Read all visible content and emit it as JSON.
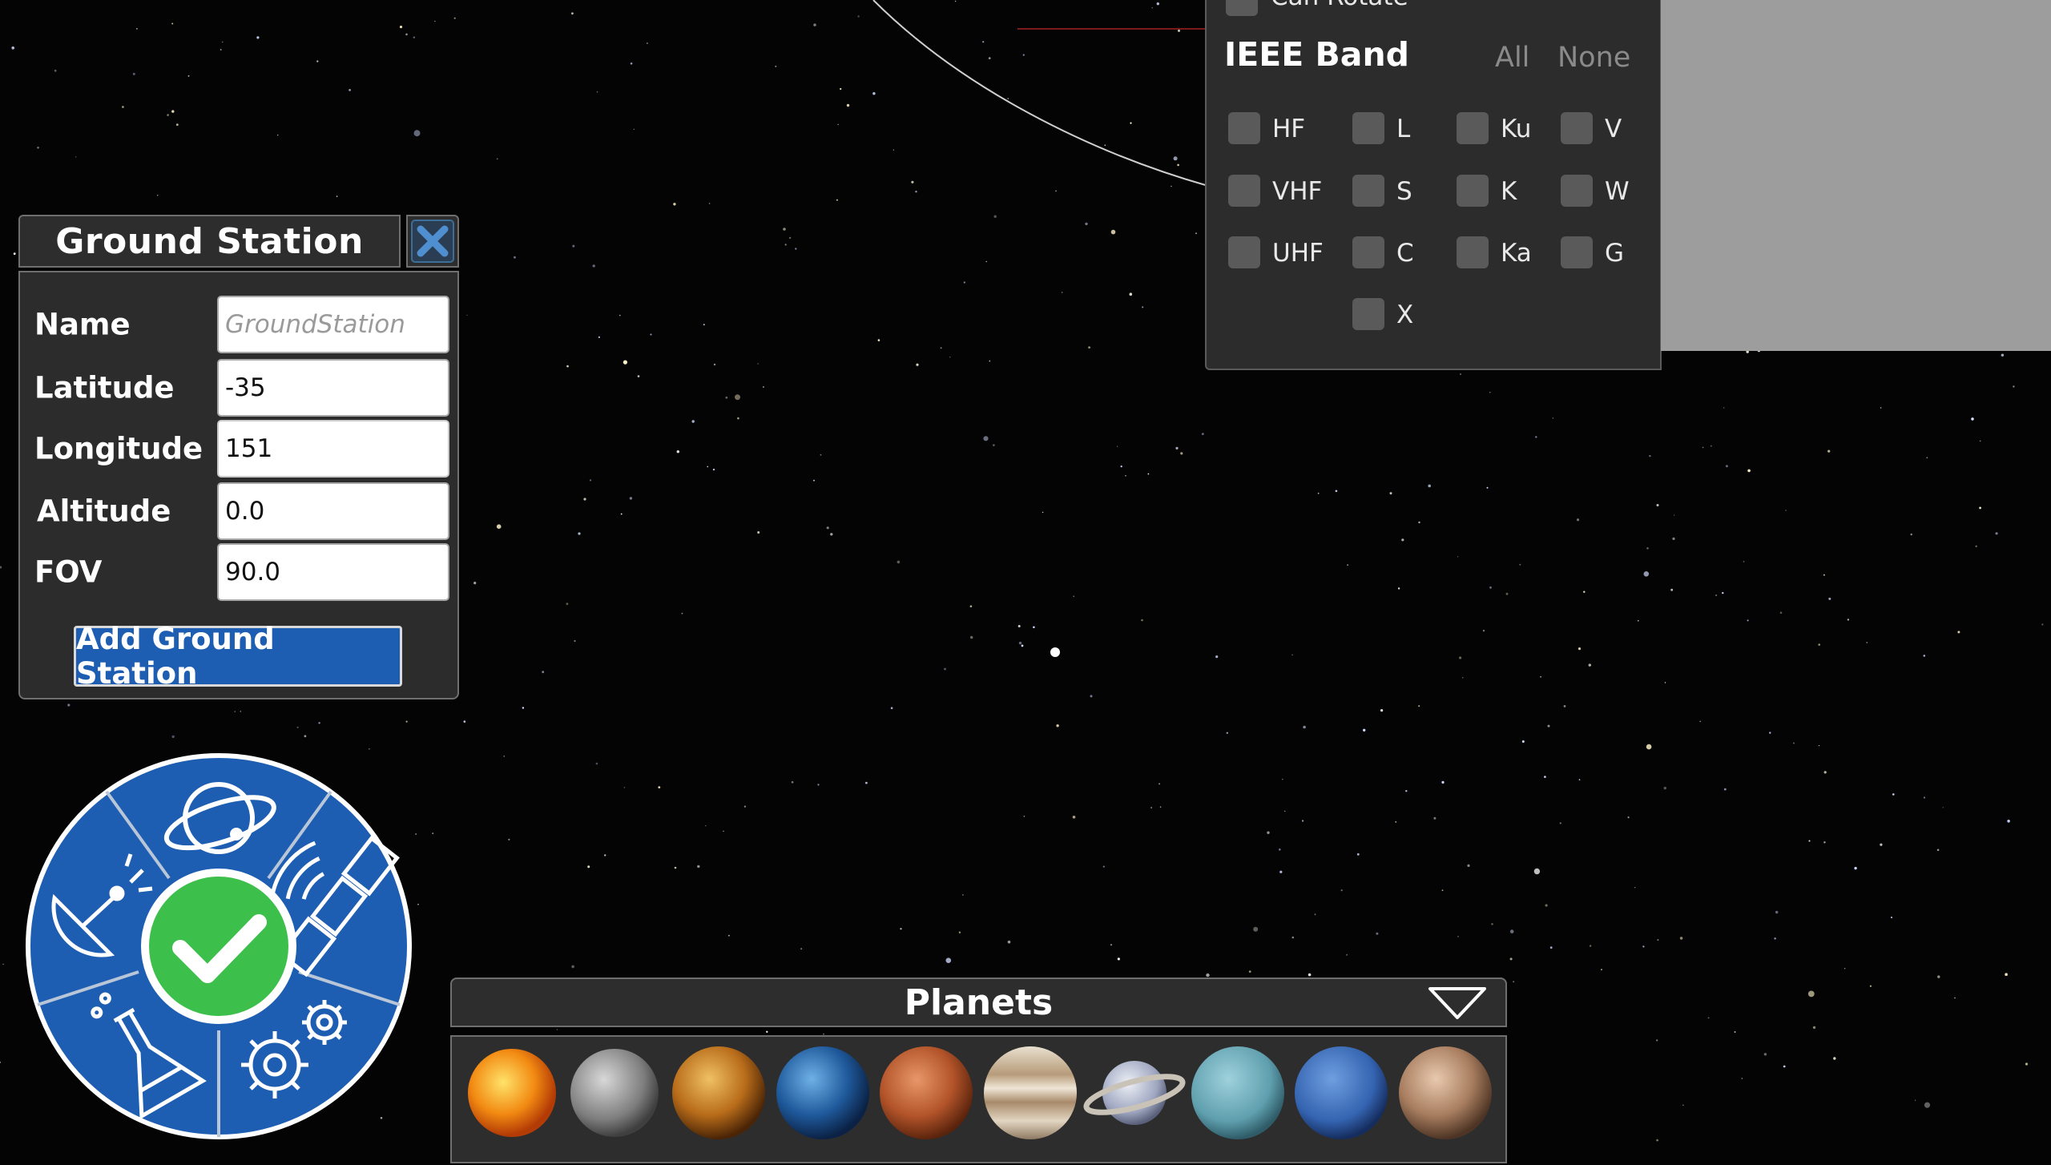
{
  "colors": {
    "menu_blue": "#1e5eb2",
    "confirm_green": "#3cbf4b",
    "panel_bg": "#2c2c2c"
  },
  "ground_station": {
    "title": "Ground Station",
    "close_icon": "close-x-icon",
    "fields": [
      {
        "label": "Name",
        "value": "",
        "placeholder": "GroundStation"
      },
      {
        "label": "Latitude",
        "value": "-35",
        "placeholder": ""
      },
      {
        "label": "Longitude",
        "value": "151",
        "placeholder": ""
      },
      {
        "label": "Altitude",
        "value": "0.0",
        "placeholder": ""
      },
      {
        "label": "FOV",
        "value": "90.0",
        "placeholder": ""
      }
    ],
    "add_button": "Add Ground Station"
  },
  "filter_panel": {
    "can_rotate_label": "Can Rotate",
    "ieee_heading": "IEEE Band",
    "all_label": "All",
    "none_label": "None",
    "bands": [
      "HF",
      "L",
      "Ku",
      "V",
      "VHF",
      "S",
      "K",
      "W",
      "UHF",
      "C",
      "Ka",
      "G",
      "X"
    ]
  },
  "radial_menu": {
    "segments": [
      "orbit-planet-icon",
      "satellite-icon",
      "gears-icon",
      "flask-icon",
      "satellite-dish-icon"
    ],
    "center": "checkmark-icon"
  },
  "planets_bar": {
    "title": "Planets",
    "toggle_icon": "chevron-down-icon",
    "planets": [
      "sun",
      "mercury",
      "venus",
      "earth",
      "mars",
      "jupiter",
      "saturn",
      "uranus",
      "neptune",
      "pluto"
    ]
  }
}
